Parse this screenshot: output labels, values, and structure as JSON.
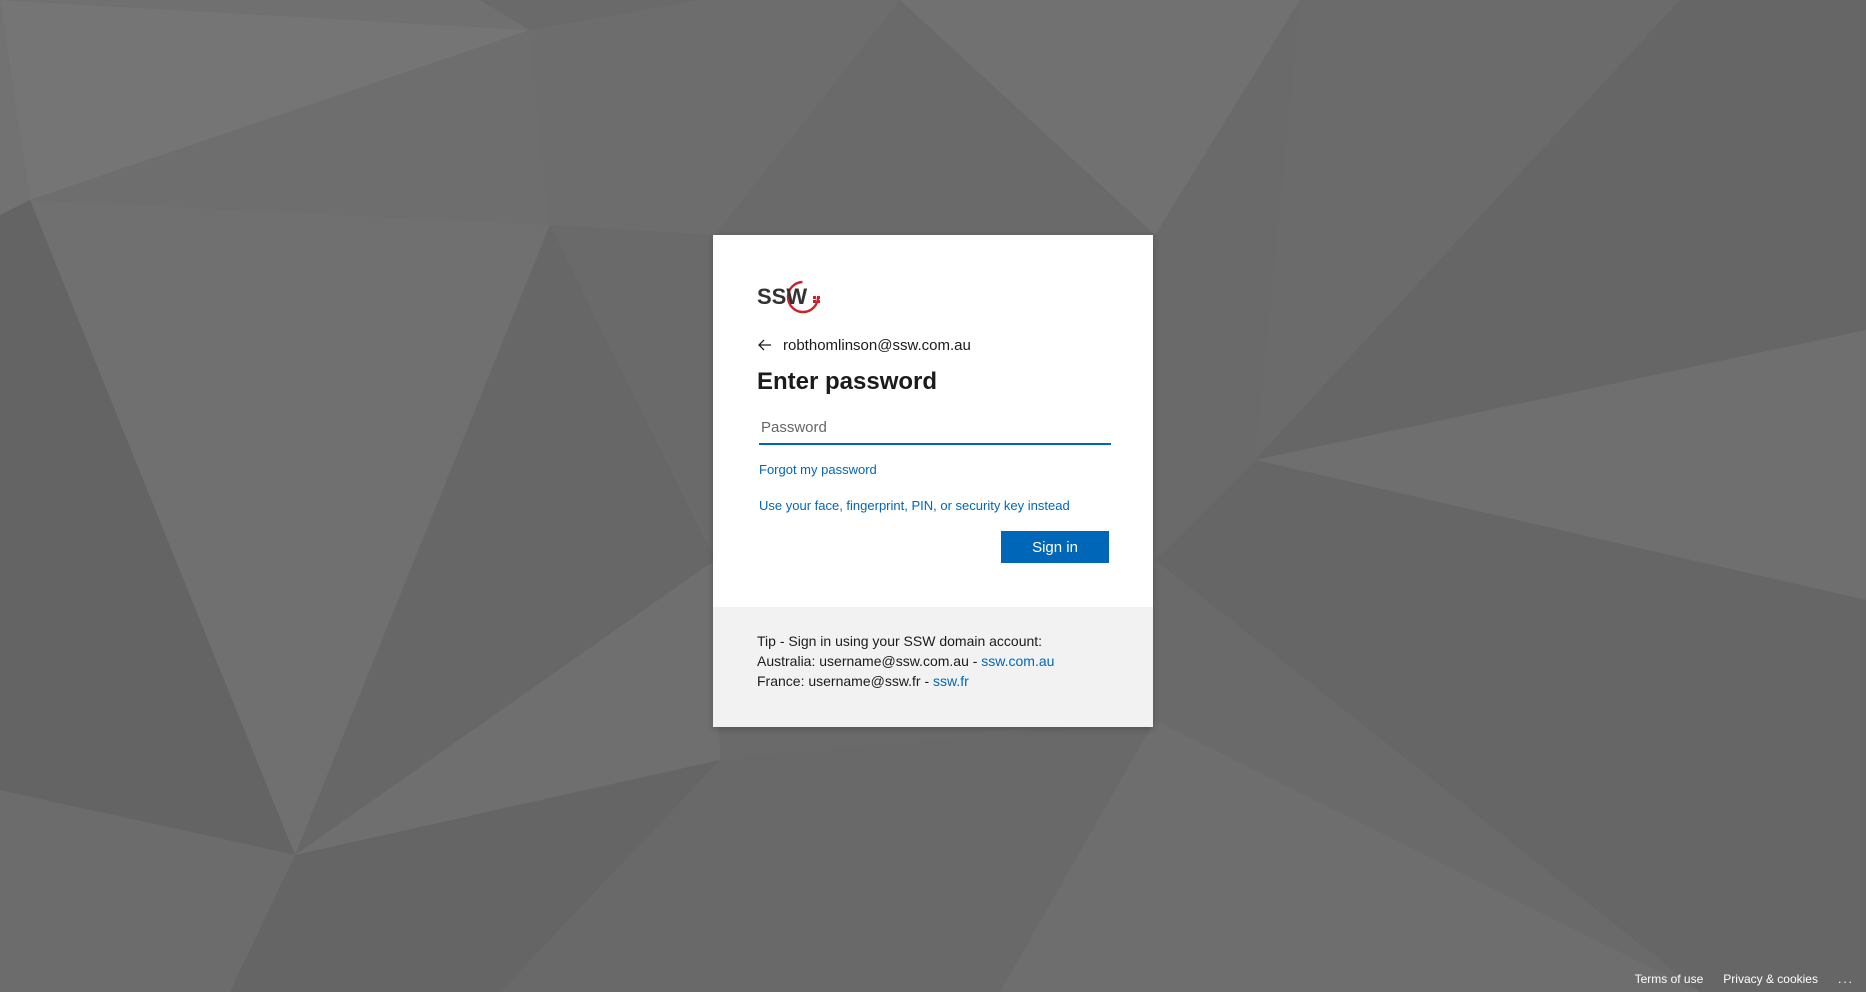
{
  "identity": {
    "email": "robthomlinson@ssw.com.au"
  },
  "form": {
    "title": "Enter password",
    "password_placeholder": "Password",
    "forgot_link": "Forgot my password",
    "alt_signin_link": "Use your face, fingerprint, PIN, or security key instead",
    "signin_button": "Sign in"
  },
  "tip": {
    "line1": "Tip - Sign in using your SSW domain account:",
    "au_prefix": "Australia: username@ssw.com.au - ",
    "au_link": "ssw.com.au",
    "fr_prefix": "France: username@ssw.fr - ",
    "fr_link": "ssw.fr"
  },
  "footer": {
    "terms": "Terms of use",
    "privacy": "Privacy & cookies",
    "more": "..."
  },
  "logo": {
    "text": "SSW",
    "accent_color": "#cc2229"
  },
  "colors": {
    "accent": "#0067b8",
    "background": "#6b6b6b",
    "tip_background": "#f2f2f2"
  },
  "icons": {
    "back": "back-arrow-icon",
    "more": "ellipsis-icon"
  }
}
